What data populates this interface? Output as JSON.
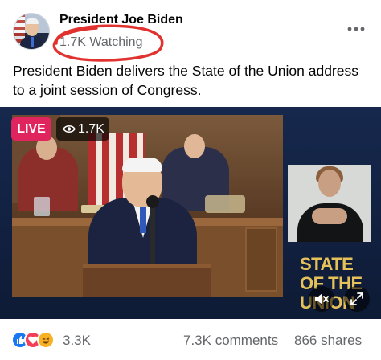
{
  "post": {
    "author": "President Joe Biden",
    "watching": "1.7K Watching",
    "caption": "President Biden delivers the State of the Union address to a joint session of Congress."
  },
  "video": {
    "live_label": "LIVE",
    "viewer_count": "1.7K",
    "overlay_text": [
      "STATE",
      "OF THE",
      "UNION"
    ]
  },
  "footer": {
    "reaction_count": "3.3K",
    "comments": "7.3K comments",
    "shares": "866 shares"
  },
  "icons": {
    "reactions": [
      "like-icon",
      "love-icon",
      "haha-icon"
    ],
    "controls": [
      "mute-icon",
      "expand-icon",
      "eye-icon",
      "more-icon"
    ]
  },
  "colors": {
    "live_badge": "#e0245e",
    "annotation_circle": "#e0332f",
    "overlay_text": "#e6c15a",
    "like": "#1877f2",
    "love": "#f33e58",
    "haha": "#f7b125"
  }
}
